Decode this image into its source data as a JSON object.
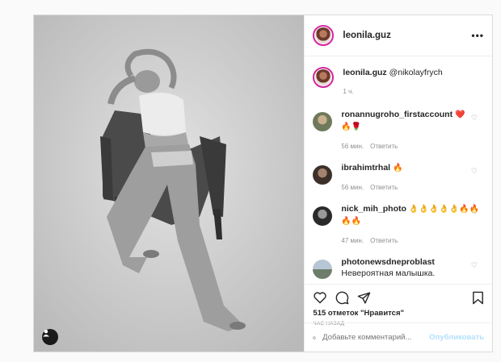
{
  "post": {
    "author": "leonila.guz",
    "caption_mention": "@nikolayfrych",
    "caption_time": "1 ч."
  },
  "comments": [
    {
      "user": "ronannugroho_firstaccount",
      "text": "❤️",
      "text2": "🔥🌹",
      "time": "56 мин.",
      "reply": "Ответить",
      "avatar_color": "#8a8f78"
    },
    {
      "user": "ibrahimtrhal",
      "text": "🔥",
      "text2": "",
      "time": "56 мин.",
      "reply": "Ответить",
      "avatar_color": "#5a4a40"
    },
    {
      "user": "nick_mih_photo",
      "text": "👌👌👌👌👌🔥🔥",
      "text2": "🔥🔥",
      "time": "47 мин.",
      "reply": "Ответить",
      "avatar_color": "#3b3b3b"
    },
    {
      "user": "photonewsdneproblast",
      "text": "Невероятная малышка.",
      "text2": "",
      "time": "",
      "reply": "",
      "avatar_color": "#8fa3b5"
    }
  ],
  "actions": {
    "likes": "515 отметок \"Нравится\"",
    "time": "час назад",
    "comment_placeholder": "Добавьте комментарий...",
    "post_label": "Опубликовать"
  },
  "icons": {
    "more": "more-icon",
    "like": "heart-icon",
    "comment": "comment-icon",
    "share": "share-icon",
    "save": "bookmark-icon",
    "emoji": "emoji-icon",
    "tag": "user-tag-icon"
  }
}
